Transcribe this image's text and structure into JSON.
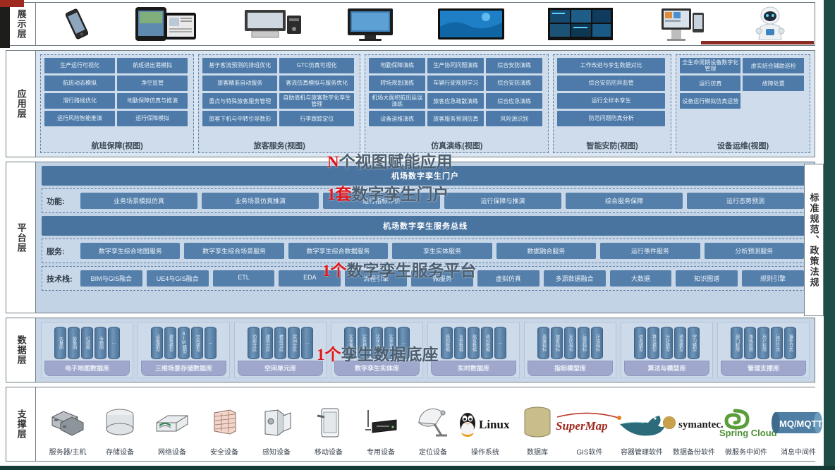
{
  "layers": {
    "presentation": {
      "label": "展示层",
      "devices": [
        {
          "name": "smartphone-icon",
          "label": "智能手机"
        },
        {
          "name": "tablet-icon",
          "label": "平板电脑"
        },
        {
          "name": "desktop-allinone-icon",
          "label": "一体机"
        },
        {
          "name": "monitor-icon",
          "label": "台式显示器"
        },
        {
          "name": "large-screen-icon",
          "label": "大屏幕"
        },
        {
          "name": "video-wall-icon",
          "label": "监控大屏"
        },
        {
          "name": "kiosk-icon",
          "label": "自助终端"
        },
        {
          "name": "robot-icon",
          "label": "服务机器人"
        }
      ]
    },
    "application": {
      "label": "应用层",
      "annotation": {
        "num": "N",
        "text": "个视图赋能应用"
      },
      "groups": [
        {
          "title": "航班保障(视图)",
          "tiles": [
            "生产运行可视化",
            "航班进出港模拟",
            "航班动态模拟",
            "净空监管",
            "滑行路线优化",
            "地勤保障仿真与推演",
            "运行风险智能推演",
            "运行保障模拟"
          ]
        },
        {
          "title": "旅客服务(视图)",
          "tiles": [
            "基于客流预测的排班优化",
            "GTC仿真可视化",
            "旅客精准自动服务",
            "客流仿真模拟与服务优化",
            "重点与特殊旅客服务管理",
            "自助值机与旅客数字化孪生管理",
            "旅客下机与中转引导数形",
            "行李跟踪定位"
          ]
        },
        {
          "title": "仿真演练(视图)",
          "tiles": [
            "地勤保障演练",
            "生产协同问题演练",
            "综合安防演练",
            "转场规划演练",
            "车辆行驶规则学习",
            "综合安防演练",
            "机场大面积航班延误演练",
            "旅客应急疏散演练",
            "综合应急演练",
            "设备运维演练",
            "旅客服务预测仿真",
            "风险源识别"
          ]
        },
        {
          "title": "智能安防(视图)",
          "tiles": [
            "工作改进与孪生数据对比",
            "综合安防防异监管",
            "运行全样本孪生",
            "防范问题防真分析"
          ]
        },
        {
          "title": "设备运维(视图)",
          "tiles": [
            "全生命周期设备数字化管理",
            "虚实结合辅助巡检",
            "运行仿真",
            "故障处置",
            "设备运行模拟仿真运营"
          ]
        }
      ]
    },
    "platform": {
      "label": "平台层",
      "portal_bus": "机场数字孪生门户",
      "service_bus": "机场数字孪生服务总线",
      "annotation_portal": {
        "num": "1套",
        "text": "数字孪生门户"
      },
      "annotation_service": {
        "num": "1个",
        "text": "数字孪生服务平台"
      },
      "function_row": {
        "label": "功能:",
        "items": [
          "业务场景模拟仿真",
          "业务场景仿真推演",
          "运行指标评价",
          "运行保障与推演",
          "综合服务保障",
          "运行态势预测"
        ]
      },
      "service_row": {
        "label": "服务:",
        "items": [
          "数字孪生综合地图服务",
          "数字孪生综合场景服务",
          "数字孪生综合数据服务",
          "孪生实体服务",
          "数据融合服务",
          "运行事件服务",
          "分析预测服务"
        ]
      },
      "tech_row": {
        "label": "技术栈:",
        "items": [
          "BIM与GIS融合",
          "UE4与GIS融合",
          "ETL",
          "EDA",
          "流程引擎",
          "微服务",
          "虚拟仿真",
          "多源数据融合",
          "大数据",
          "知识图谱",
          "规则引擎"
        ]
      }
    },
    "data": {
      "label": "数据层",
      "annotation": {
        "num": "1个",
        "text": "孪生数据底座"
      },
      "groups": [
        {
          "base": "电子地图数据库",
          "cylinders": [
            "矢量图",
            "影像图",
            "红线图",
            "专题图",
            "…"
          ]
        },
        {
          "base": "三维场景存储数据库",
          "cylinders": [
            "设备模型",
            "建筑模型",
            "BIM模型",
            "空间模型",
            "…"
          ]
        },
        {
          "base": "空间单元库",
          "cylinders": [
            "功能分区",
            "建筑分区",
            "楼层分区",
            "房间分区",
            "…"
          ]
        },
        {
          "base": "数字孪生实体库",
          "cylinders": [
            "实体属性",
            "实体模型",
            "实体关系",
            "实体状态",
            "…"
          ]
        },
        {
          "base": "实时数据库",
          "cylinders": [
            "感知数据",
            "业务数据",
            "航班数据",
            "移动数据",
            "…"
          ]
        },
        {
          "base": "指标模型库",
          "cylinders": [
            "高度指标",
            "旅客指标",
            "安防指标",
            "运营指标",
            "环境指标"
          ]
        },
        {
          "base": "算法与模型库",
          "cylinders": [
            "仿真模型",
            "算法模型",
            "分析模型",
            "预测模型",
            "学习模型"
          ]
        },
        {
          "base": "管理支撑库",
          "cylinders": [
            "部门权限",
            "角色权限",
            "用户权限",
            "运行日志",
            "操作日志"
          ]
        }
      ]
    },
    "support": {
      "label": "支撑层",
      "items": [
        {
          "icon": "server-host-icon",
          "label": "服务器/主机"
        },
        {
          "icon": "storage-device-icon",
          "label": "存储设备"
        },
        {
          "icon": "network-device-icon",
          "label": "网络设备"
        },
        {
          "icon": "security-device-icon",
          "label": "安全设备"
        },
        {
          "icon": "sensing-device-icon",
          "label": "感知设备"
        },
        {
          "icon": "mobile-device-icon",
          "label": "移动设备"
        },
        {
          "icon": "dedicated-device-icon",
          "label": "专用设备"
        },
        {
          "icon": "positioning-device-icon",
          "label": "定位设备"
        },
        {
          "icon": "linux-os-icon",
          "label": "操作系统"
        },
        {
          "icon": "database-icon",
          "label": "数据库"
        },
        {
          "icon": "supermap-gis-icon",
          "label": "GIS软件"
        },
        {
          "icon": "docker-container-icon",
          "label": "容器管理软件"
        },
        {
          "icon": "symantec-backup-icon",
          "label": "数据备份软件"
        },
        {
          "icon": "spring-cloud-icon",
          "label": "微服务中间件"
        },
        {
          "icon": "mq-mqtt-icon",
          "label": "消息中间件"
        }
      ],
      "brand_labels": {
        "linux": "Linux",
        "supermap": "SuperMap",
        "symantec": "symantec.",
        "spring_cloud": "Spring Cloud",
        "mq": "MQ/MQTT"
      }
    },
    "standards": {
      "label": "标准规范、政策法规"
    }
  }
}
